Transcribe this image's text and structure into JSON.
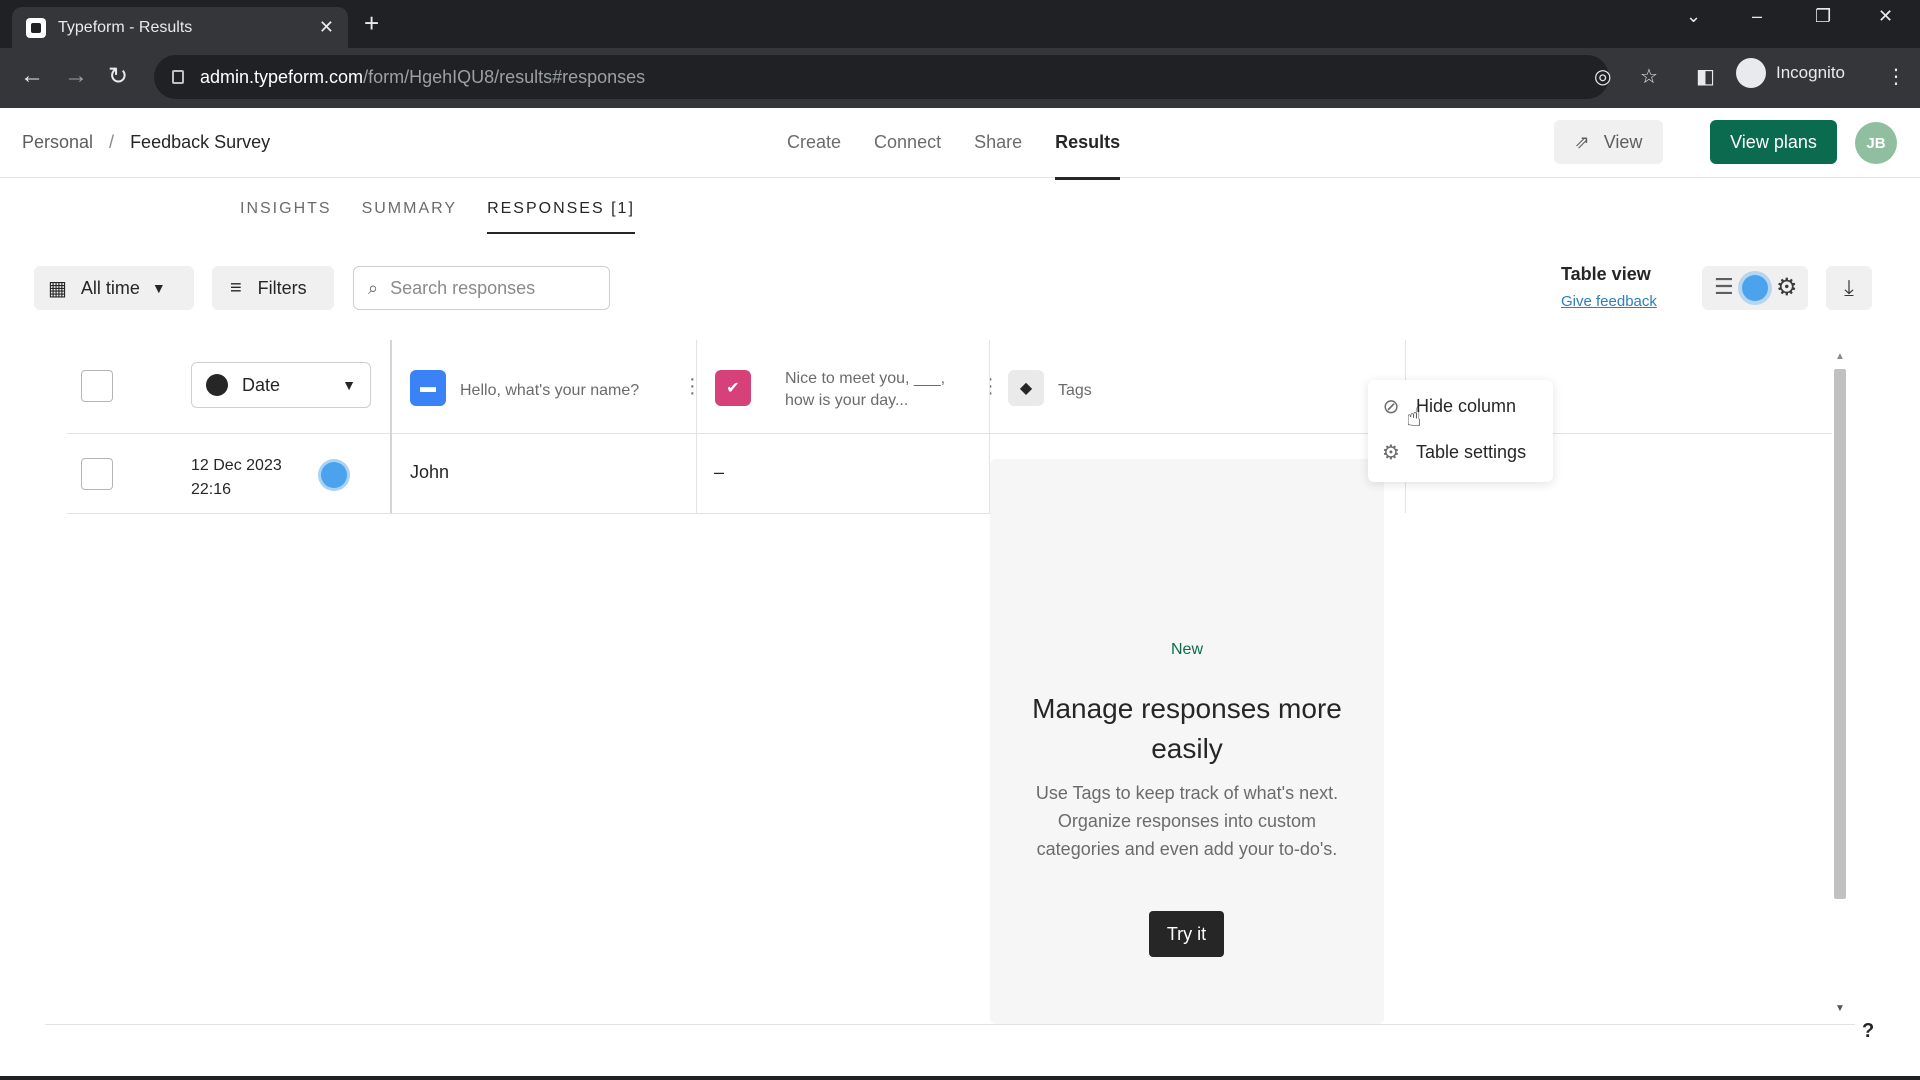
{
  "browser": {
    "tab_title": "Typeform - Results",
    "url_host": "admin.typeform.com",
    "url_path": "/form/HgehIQU8/results#responses",
    "incognito_label": "Incognito"
  },
  "header": {
    "breadcrumb_root": "Personal",
    "breadcrumb_current": "Feedback Survey",
    "nav": [
      "Create",
      "Connect",
      "Share",
      "Results"
    ],
    "view_label": "View",
    "plans_label": "View plans",
    "avatar_initials": "JB"
  },
  "subtabs": [
    "INSIGHTS",
    "SUMMARY",
    "RESPONSES [1]"
  ],
  "toolbar": {
    "date_filter": "All time",
    "filters_label": "Filters",
    "search_placeholder": "Search responses",
    "table_view_label": "Table view",
    "feedback_link": "Give feedback"
  },
  "table": {
    "date_column": "Date",
    "q1": "Hello, what's your name?",
    "q2_line1": "Nice to meet you, ___,",
    "q2_line2": "how is your day...",
    "tags_column": "Tags",
    "rows": [
      {
        "date": "12 Dec 2023",
        "time": "22:16",
        "name": "John",
        "q2": "–"
      }
    ]
  },
  "tags_promo": {
    "badge": "New",
    "heading": "Manage responses more easily",
    "body": "Use Tags to keep track of what's next. Organize responses into custom categories and even add your to-do's.",
    "cta": "Try it"
  },
  "context_menu": {
    "hide_column": "Hide column",
    "table_settings": "Table settings"
  },
  "colors": {
    "brand_green": "#0a6b4e",
    "q1_badge": "#3b82f6",
    "q2_badge": "#d6417a"
  }
}
